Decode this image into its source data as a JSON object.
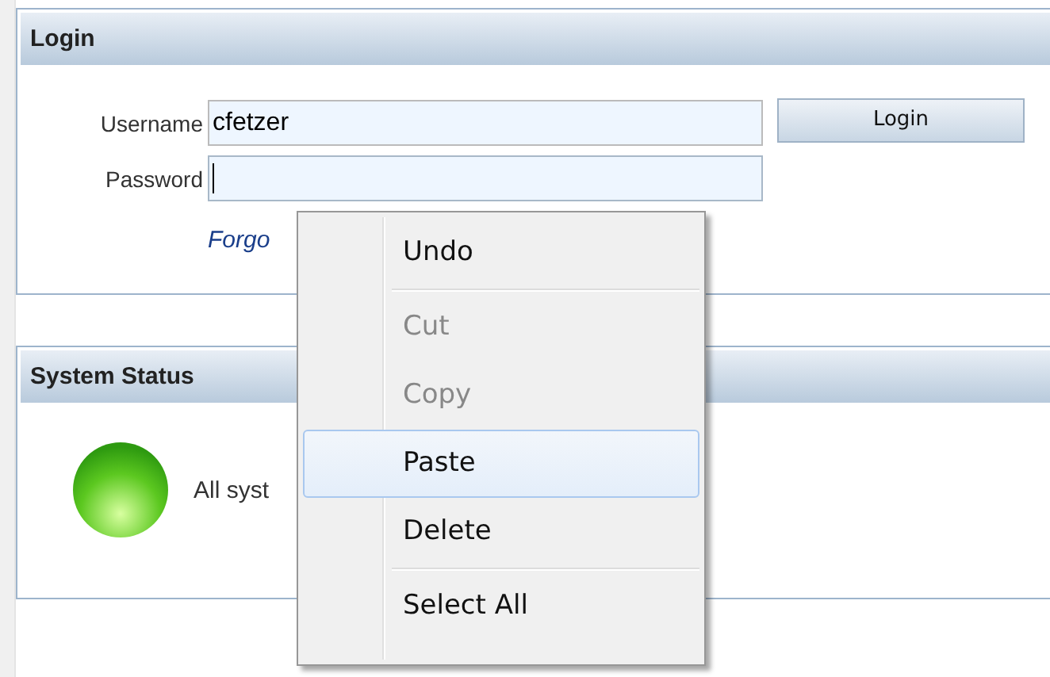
{
  "login_panel": {
    "title": "Login",
    "fields": [
      {
        "label": "Username",
        "value": "cfetzer",
        "focused": false
      },
      {
        "label": "Password",
        "focused": true
      }
    ],
    "button": "Login",
    "link": "Forgo"
  },
  "status_panel": {
    "title": "System Status",
    "healthy": true,
    "message": "All syst"
  },
  "context_menu": {
    "items": [
      {
        "kind": "item",
        "label": "Undo",
        "disabled": false,
        "selected": false
      },
      {
        "kind": "separator"
      },
      {
        "kind": "item",
        "label": "Cut",
        "disabled": true,
        "selected": false
      },
      {
        "kind": "item",
        "label": "Copy",
        "disabled": true,
        "selected": false
      },
      {
        "kind": "item",
        "label": "Paste",
        "disabled": false,
        "selected": true
      },
      {
        "kind": "item",
        "label": "Delete",
        "disabled": false,
        "selected": false
      },
      {
        "kind": "separator"
      },
      {
        "kind": "item",
        "label": "Select All",
        "disabled": false,
        "selected": false
      }
    ]
  }
}
